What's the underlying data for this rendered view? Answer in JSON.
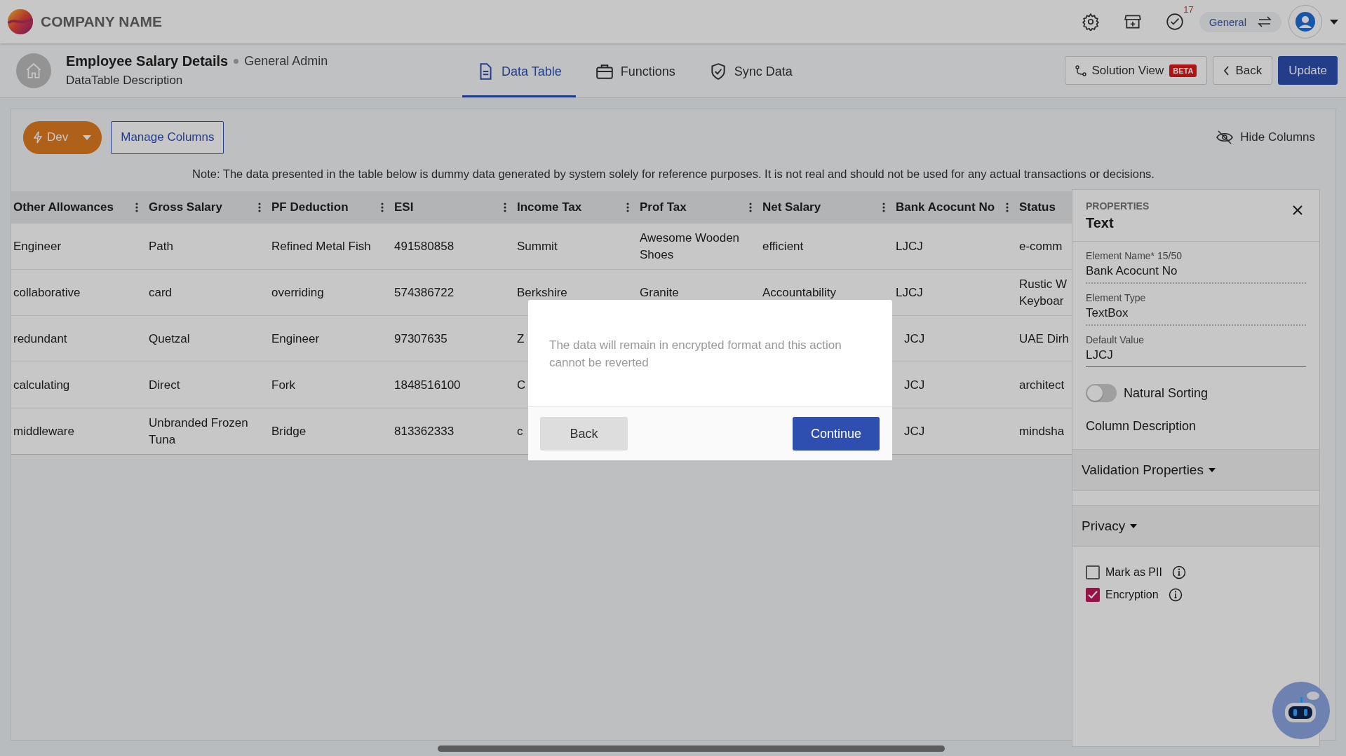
{
  "header": {
    "company": "COMPANY NAME",
    "notification_count": "17",
    "workspace": "General"
  },
  "page": {
    "title": "Employee Salary Details",
    "role": "General Admin",
    "description": "DataTable Description"
  },
  "tabs": [
    {
      "label": "Data Table",
      "selected": true,
      "kind": "table"
    },
    {
      "label": "Functions",
      "selected": false,
      "kind": "functions"
    },
    {
      "label": "Sync Data",
      "selected": false,
      "kind": "sync"
    }
  ],
  "actions": {
    "solution_view": "Solution View",
    "badge": "BETA",
    "back": "Back",
    "update": "Update"
  },
  "toolbar": {
    "environment": "Dev",
    "manage_columns": "Manage Columns",
    "hide_columns": "Hide Columns"
  },
  "note": "Note: The data presented in the table below is dummy data generated by system solely for reference purposes. It is not real and should not be used for any actual transactions or decisions.",
  "table": {
    "columns": [
      {
        "label": "Other Allowances",
        "menu": true
      },
      {
        "label": "Gross Salary",
        "menu": true
      },
      {
        "label": "PF Deduction",
        "menu": true
      },
      {
        "label": "ESI",
        "menu": true
      },
      {
        "label": "Income Tax",
        "menu": true
      },
      {
        "label": "Prof Tax",
        "menu": true
      },
      {
        "label": "Net Salary",
        "menu": true
      },
      {
        "label": "Bank Acocunt No",
        "menu": true
      },
      {
        "label": "Status",
        "menu": false
      }
    ],
    "rows": [
      [
        "Engineer",
        "Path",
        "Refined Metal Fish",
        "491580858",
        "Summit",
        "Awesome Wooden Shoes",
        "efficient",
        "LJCJ",
        "e-comm"
      ],
      [
        "collaborative",
        "card",
        "overriding",
        "574386722",
        "Berkshire",
        "Granite",
        "Accountability",
        "LJCJ",
        "Rustic W\nKeyboar"
      ],
      [
        "redundant",
        "Quetzal",
        "Engineer",
        "97307635",
        "Z",
        null,
        null,
        "JCJ",
        "UAE Dirh"
      ],
      [
        "calculating",
        "Direct",
        "Fork",
        "1848516100",
        "C",
        null,
        null,
        "JCJ",
        "architect"
      ],
      [
        "middleware",
        "Unbranded Frozen Tuna",
        "Bridge",
        "813362333",
        "c",
        null,
        null,
        "JCJ",
        "mindsha"
      ]
    ]
  },
  "properties": {
    "heading": "PROPERTIES",
    "title": "Text",
    "fields": [
      {
        "label": "Element Name* 15/50",
        "value": "Bank Acocunt No",
        "kind": "dotted"
      },
      {
        "label": "Element Type",
        "value": "TextBox",
        "kind": "dotted"
      },
      {
        "label": "Default Value",
        "value": "LJCJ",
        "kind": "solid"
      }
    ],
    "toggle": {
      "label": "Natural Sorting",
      "on": false
    },
    "column_description": "Column Description",
    "sections": [
      {
        "label": "Validation Properties"
      },
      {
        "label": "Privacy"
      }
    ],
    "privacy": [
      {
        "label": "Mark as PII",
        "checked": false
      },
      {
        "label": "Encryption",
        "checked": true
      }
    ]
  },
  "dialog": {
    "message": "The data will remain in encrypted format and this action cannot be reverted",
    "back": "Back",
    "continue": "Continue"
  }
}
